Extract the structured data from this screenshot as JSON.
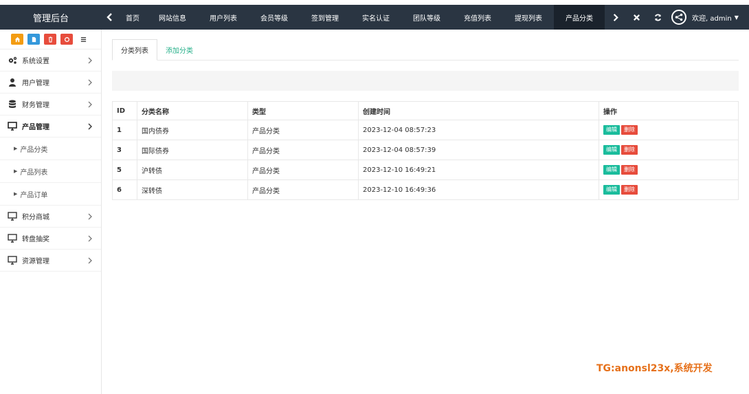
{
  "header": {
    "brand": "管理后台",
    "tabs": [
      {
        "label": "首页"
      },
      {
        "label": "网站信息"
      },
      {
        "label": "用户列表"
      },
      {
        "label": "会员等级"
      },
      {
        "label": "签到管理"
      },
      {
        "label": "实名认证"
      },
      {
        "label": "团队等级"
      },
      {
        "label": "充值列表"
      },
      {
        "label": "提现列表"
      },
      {
        "label": "产品分类"
      }
    ],
    "user_label": "欢迎, admin"
  },
  "sidebar": {
    "quick_buttons": [
      {
        "icon": "home-icon",
        "color": "#f39c12"
      },
      {
        "icon": "file-icon",
        "color": "#3498db"
      },
      {
        "icon": "trash-icon",
        "color": "#e74c3c"
      },
      {
        "icon": "recycle-icon",
        "color": "#e74c3c"
      },
      {
        "icon": "list-icon",
        "color": "#ffffff"
      }
    ],
    "menu": [
      {
        "label": "系统设置",
        "icon": "gears-icon"
      },
      {
        "label": "用户管理",
        "icon": "user-icon"
      },
      {
        "label": "财务管理",
        "icon": "database-icon"
      },
      {
        "label": "产品管理",
        "icon": "monitor-icon"
      },
      {
        "label": "积分商城",
        "icon": "monitor-icon"
      },
      {
        "label": "转盘抽奖",
        "icon": "monitor-icon"
      },
      {
        "label": "资源管理",
        "icon": "monitor-icon"
      }
    ],
    "sub_menu": [
      {
        "label": "产品分类"
      },
      {
        "label": "产品列表"
      },
      {
        "label": "产品订单"
      }
    ]
  },
  "main": {
    "tabs": [
      {
        "label": "分类列表"
      },
      {
        "label": "添加分类"
      }
    ],
    "table": {
      "headers": [
        "ID",
        "分类名称",
        "类型",
        "创建时间",
        "操作"
      ],
      "rows": [
        {
          "id": "1",
          "name": "国内债券",
          "type": "产品分类",
          "created": "2023-12-04 08:57:23"
        },
        {
          "id": "3",
          "name": "国际债券",
          "type": "产品分类",
          "created": "2023-12-04 08:57:39"
        },
        {
          "id": "5",
          "name": "沪转债",
          "type": "产品分类",
          "created": "2023-12-10 16:49:21"
        },
        {
          "id": "6",
          "name": "深转债",
          "type": "产品分类",
          "created": "2023-12-10 16:49:36"
        }
      ],
      "edit_label": "编辑",
      "delete_label": "删除"
    }
  },
  "watermark": "TG:anonsl23x,系统开发",
  "colors": {
    "topbar": "#2a3542",
    "accent_green": "#1abc9c",
    "danger_red": "#e74c3c",
    "link_green": "#27b08a"
  }
}
